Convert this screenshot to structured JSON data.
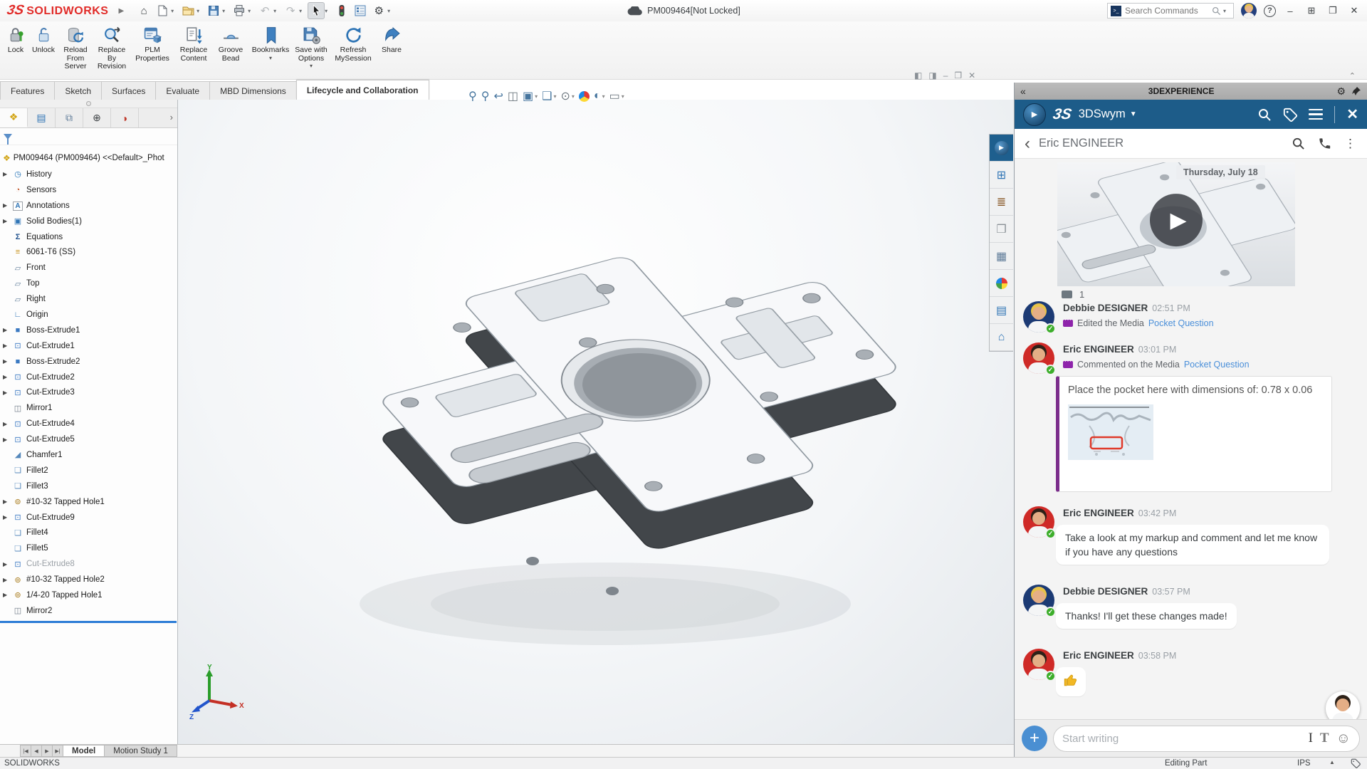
{
  "title_bar": {
    "logo_mark": "3S",
    "logo_text": "SOLIDWORKS",
    "document_title": "PM009464[Not Locked]",
    "search_placeholder": "Search Commands"
  },
  "icons": {
    "home": "⌂",
    "undo": "↶",
    "redo": "↷",
    "gear": "⚙",
    "dropdown": "▾",
    "collapse-left": "«",
    "collapse-up": "⌃",
    "back": "‹",
    "overflow": "⋮",
    "close": "✕",
    "play": "▶",
    "smiley": "☺",
    "expand-right": "›",
    "check": "✓",
    "help": "?",
    "minimize": "–",
    "restore": "❐",
    "dock": "⊞",
    "dock-pane-left": "◧",
    "dock-pane-right": "◨"
  },
  "toolbar": {
    "buttons": [
      {
        "label": "Lock"
      },
      {
        "label": "Unlock"
      },
      {
        "label": "Reload From Server"
      },
      {
        "label": "Replace By Revision"
      },
      {
        "label": "PLM Properties"
      },
      {
        "label": "Replace Content"
      },
      {
        "label": "Groove Bead"
      },
      {
        "label": "Bookmarks",
        "dropdown": true
      },
      {
        "label": "Save with Options",
        "dropdown": true
      },
      {
        "label": "Refresh MySession"
      },
      {
        "label": "Share"
      }
    ]
  },
  "ribbon_tabs": [
    {
      "label": "Features"
    },
    {
      "label": "Sketch"
    },
    {
      "label": "Surfaces"
    },
    {
      "label": "Evaluate"
    },
    {
      "label": "MBD Dimensions"
    },
    {
      "label": "Lifecycle and Collaboration",
      "active": true
    }
  ],
  "feature_tree": {
    "root_label": "PM009464 (PM009464) <<Default>_Phot",
    "items": [
      {
        "label": "History",
        "icon": "history",
        "arrow": true
      },
      {
        "label": "Sensors",
        "icon": "sensors"
      },
      {
        "label": "Annotations",
        "icon": "annotations",
        "arrow": true
      },
      {
        "label": "Solid Bodies(1)",
        "icon": "solids",
        "arrow": true
      },
      {
        "label": "Equations",
        "icon": "equations"
      },
      {
        "label": "6061-T6 (SS)",
        "icon": "material"
      },
      {
        "label": "Front",
        "icon": "plane"
      },
      {
        "label": "Top",
        "icon": "plane"
      },
      {
        "label": "Right",
        "icon": "plane"
      },
      {
        "label": "Origin",
        "icon": "origin"
      },
      {
        "label": "Boss-Extrude1",
        "icon": "boss",
        "arrow": true
      },
      {
        "label": "Cut-Extrude1",
        "icon": "cut",
        "arrow": true
      },
      {
        "label": "Boss-Extrude2",
        "icon": "boss",
        "arrow": true
      },
      {
        "label": "Cut-Extrude2",
        "icon": "cut",
        "arrow": true
      },
      {
        "label": "Cut-Extrude3",
        "icon": "cut",
        "arrow": true
      },
      {
        "label": "Mirror1",
        "icon": "mirror"
      },
      {
        "label": "Cut-Extrude4",
        "icon": "cut",
        "arrow": true
      },
      {
        "label": "Cut-Extrude5",
        "icon": "cut",
        "arrow": true
      },
      {
        "label": "Chamfer1",
        "icon": "chamfer"
      },
      {
        "label": "Fillet2",
        "icon": "fillet"
      },
      {
        "label": "Fillet3",
        "icon": "fillet"
      },
      {
        "label": "#10-32 Tapped Hole1",
        "icon": "hole",
        "arrow": true
      },
      {
        "label": "Cut-Extrude9",
        "icon": "cut",
        "arrow": true
      },
      {
        "label": "Fillet4",
        "icon": "fillet"
      },
      {
        "label": "Fillet5",
        "icon": "fillet"
      },
      {
        "label": "Cut-Extrude8",
        "icon": "cut",
        "arrow": true,
        "dim": true
      },
      {
        "label": "#10-32 Tapped Hole2",
        "icon": "hole",
        "arrow": true
      },
      {
        "label": "1/4-20 Tapped Hole1",
        "icon": "hole",
        "arrow": true
      },
      {
        "label": "Mirror2",
        "icon": "mirror"
      }
    ]
  },
  "viewport": {
    "triad": {
      "x": "X",
      "y": "Y",
      "z": "Z"
    }
  },
  "task_pane": {
    "items": [
      {
        "icon": "compass",
        "selected": true
      },
      {
        "icon": "resources"
      },
      {
        "icon": "library"
      },
      {
        "icon": "explorer"
      },
      {
        "icon": "palette"
      },
      {
        "icon": "appearances"
      },
      {
        "icon": "properties"
      },
      {
        "icon": "forum"
      }
    ]
  },
  "right_panel": {
    "header_title": "3DEXPERIENCE",
    "logo_mark": "3S",
    "app_name": "3DSwym",
    "conversation_title": "Eric ENGINEER",
    "video": {
      "date_badge": "Thursday, July 18",
      "comment_count": "1"
    },
    "messages": [
      {
        "author": "Debbie DESIGNER",
        "time": "02:51 PM",
        "activity": "Edited the Media",
        "link": "Pocket Question"
      },
      {
        "author": "Eric ENGINEER",
        "time": "03:01 PM",
        "activity": "Commented on the Media",
        "link": "Pocket Question",
        "quote_text": "Place the pocket here with dimensions of:  0.78 x 0.06"
      },
      {
        "author": "Eric ENGINEER",
        "time": "03:42 PM",
        "text": "Take a look at my markup and comment and let me know if you have any questions"
      },
      {
        "author": "Debbie DESIGNER",
        "time": "03:57 PM",
        "text": "Thanks!  I'll get these changes made!"
      },
      {
        "author": "Eric ENGINEER",
        "time": "03:58 PM",
        "emoji": "thumbs-up-icon"
      }
    ],
    "input_placeholder": "Start writing"
  },
  "bottom_bar": {
    "tabs": [
      {
        "label": "Model",
        "active": true
      },
      {
        "label": "Motion Study 1"
      }
    ]
  },
  "status_bar": {
    "left": "SOLIDWORKS",
    "mode": "Editing Part",
    "units": "IPS"
  },
  "colors": {
    "swym_blue": "#1d5c89",
    "link_blue": "#4a8fd9",
    "quote_purple": "#7b2d8b",
    "accent_blue": "#2e74b5",
    "rollback_blue": "#2b7cd6",
    "logo_red": "#e12b28"
  }
}
